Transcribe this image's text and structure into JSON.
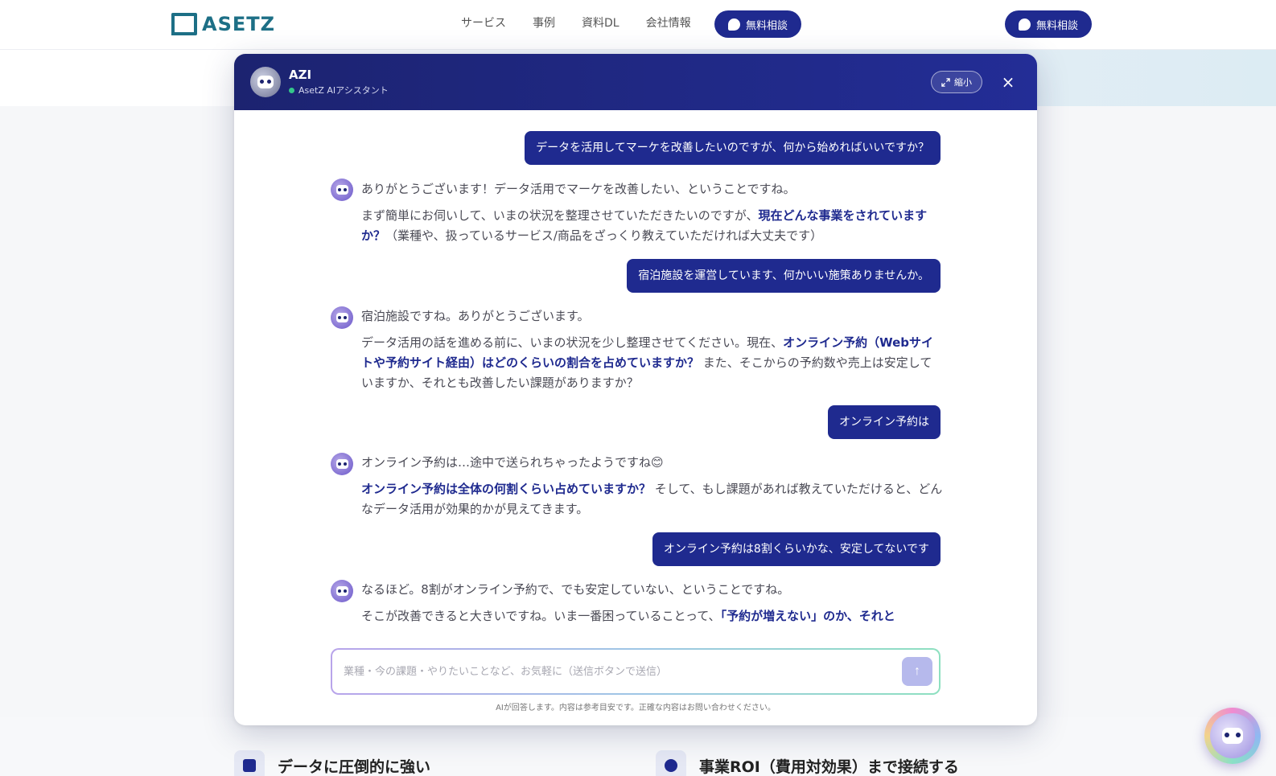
{
  "nav": {
    "logo_text": "ASETZ",
    "links": [
      "サービス",
      "事例",
      "資料DL",
      "会社情報"
    ],
    "cta_label": "無料相談",
    "cta_label_2": "無料相談"
  },
  "features": [
    {
      "title": "データに圧倒的に強い"
    },
    {
      "title": "事業ROI（費用対効果）まで接続する"
    }
  ],
  "chat": {
    "name": "AZI",
    "subtitle": "AsetZ AIアシスタント",
    "shrink_label": "縮小",
    "close_icon": "×",
    "messages": [
      {
        "role": "user",
        "text": "データを活用してマーケを改善したいのですが、何から始めればいいですか？"
      },
      {
        "role": "ai",
        "p1": "ありがとうございます！データ活用でマーケを改善したい、ということですね。",
        "p2a": "まず簡単にお伺いして、いまの状況を整理させていただきたいのですが、",
        "p2em": "現在どんな事業をされていますか？",
        "p2b": "（業種や、扱っているサービス/商品をざっくり教えていただければ大丈夫です）"
      },
      {
        "role": "user",
        "text": "宿泊施設を運営しています、何かいい施策ありませんか。"
      },
      {
        "role": "ai",
        "p1": "宿泊施設ですね。ありがとうございます。",
        "p2a": "データ活用の話を進める前に、いまの状況を少し整理させてください。現在、",
        "p2em": "オンライン予約（Webサイトや予約サイト経由）はどのくらいの割合を占めていますか？",
        "p2b": " また、そこからの予約数や売上は安定していますか、それとも改善したい課題がありますか？"
      },
      {
        "role": "user",
        "text": "オンライン予約は"
      },
      {
        "role": "ai",
        "p1": "オンライン予約は…途中で送られちゃったようですね😊",
        "p2a": "",
        "p2em": "オンライン予約は全体の何割くらい占めていますか？",
        "p2b": " そして、もし課題があれば教えていただけると、どんなデータ活用が効果的かが見えてきます。"
      },
      {
        "role": "user",
        "text": "オンライン予約は8割くらいかな、安定してないです"
      },
      {
        "role": "ai",
        "p1": "なるほど。8割がオンライン予約で、でも安定していない、ということですね。",
        "p2a": "そこが改善できると大きいですね。いま一番困っていることって、",
        "p2em": "「予約が増えない」のか、それと",
        "p2b": ""
      }
    ],
    "input_placeholder": "業種・今の課題・やりたいことなど、お気軽に（送信ボタンで送信）",
    "input_value": "",
    "send_icon": "↑",
    "disclaimer": "AIが回答します。内容は参考目安です。正確な内容はお問い合わせください。"
  },
  "colors": {
    "primary": "#1f2a8f",
    "header_dark": "#1c2370",
    "logo": "#1d6f86",
    "status_online": "#34c78a"
  },
  "icons": [
    "chat-bubble-icon",
    "robot-avatar-icon",
    "expand-icon",
    "close-icon",
    "send-arrow-icon"
  ]
}
